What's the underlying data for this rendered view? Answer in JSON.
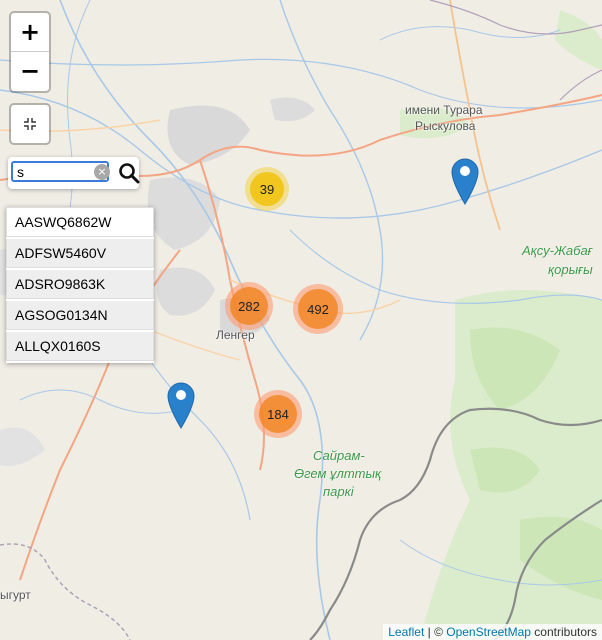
{
  "map": {
    "labels": {
      "town_turara_line1": "имени Турара",
      "town_turara_line2": "Рыскулова",
      "town_lenger": "Ленгер",
      "town_bottom_left": "ыгурт",
      "park_aksu_line1": "Ақсу-Жабағ",
      "park_aksu_line2": "қорығы",
      "park_sairam_line1": "Сайрам-",
      "park_sairam_line2": "Өгем ұлттық",
      "park_sairam_line3": "паркі"
    },
    "clusters": [
      {
        "count": "39",
        "color": "yellow"
      },
      {
        "count": "282",
        "color": "orange"
      },
      {
        "count": "492",
        "color": "orange"
      },
      {
        "count": "184",
        "color": "orange"
      }
    ],
    "markers": [
      {
        "icon": "map-pin-icon",
        "color": "#2a81cb"
      },
      {
        "icon": "map-pin-icon",
        "color": "#2a81cb"
      }
    ]
  },
  "controls": {
    "zoom_in_label": "+",
    "zoom_out_label": "−",
    "fullscreen_icon": "fullscreen-icon",
    "search": {
      "value": "s",
      "clear_label": "×",
      "search_icon": "search-icon"
    },
    "results": [
      "AASWQ6862W",
      "ADFSW5460V",
      "ADSRO9863K",
      "AGSOG0134N",
      "ALLQX0160S"
    ]
  },
  "attribution": {
    "leaflet": "Leaflet",
    "separator": " | © ",
    "osm": "OpenStreetMap",
    "contributors": " contributors"
  },
  "colors": {
    "land": "#f0ede5",
    "urban": "#d9d9d9",
    "forest": "#cde6b8",
    "river": "#a8c8e8",
    "road": "#f4a583",
    "border": "#8a8a8a",
    "marker": "#2a81cb",
    "cluster_yellow": "#f0c20c",
    "cluster_orange": "#f18017"
  }
}
